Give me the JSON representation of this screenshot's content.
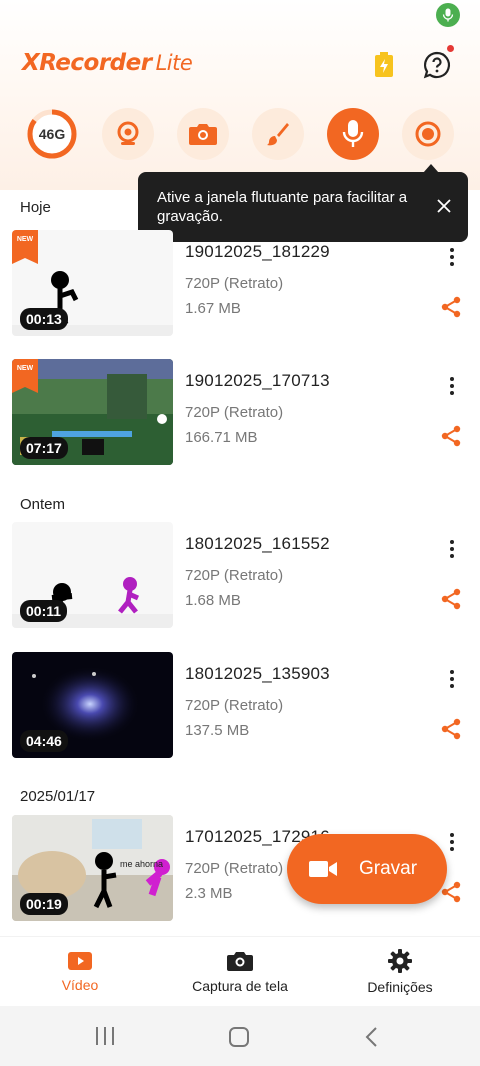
{
  "app": {
    "title": "XRecorder",
    "title_suffix": "Lite",
    "accent": "#f26722"
  },
  "quick_actions": {
    "storage_label": "46G",
    "items": [
      "storage",
      "facecam-icon",
      "screenshot-icon",
      "brush-icon",
      "microphone-icon",
      "record-icon"
    ]
  },
  "tooltip": {
    "text": "Ative a janela flutuante para facilitar a gravação."
  },
  "sections": [
    {
      "label": "Hoje",
      "videos": [
        {
          "name": "19012025_181229",
          "resolution": "720P (Retrato)",
          "size": "1.67 MB",
          "duration": "00:13",
          "badge": "NEW"
        },
        {
          "name": "19012025_170713",
          "resolution": "720P (Retrato)",
          "size": "166.71 MB",
          "duration": "07:17",
          "badge": "NEW"
        }
      ]
    },
    {
      "label": "Ontem",
      "videos": [
        {
          "name": "18012025_161552",
          "resolution": "720P (Retrato)",
          "size": "1.68 MB",
          "duration": "00:11"
        },
        {
          "name": "18012025_135903",
          "resolution": "720P (Retrato)",
          "size": "137.5 MB",
          "duration": "04:46"
        }
      ]
    },
    {
      "label": "2025/01/17",
      "videos": [
        {
          "name": "17012025_172916",
          "resolution": "720P (Retrato)",
          "size": "2.3 MB",
          "duration": "00:19",
          "thumb_caption": "me ahorna"
        }
      ]
    }
  ],
  "fab": {
    "label": "Gravar"
  },
  "bottom_nav": [
    {
      "label": "Vídeo",
      "icon": "video-icon",
      "active": true
    },
    {
      "label": "Captura de tela",
      "icon": "camera-icon",
      "active": false
    },
    {
      "label": "Definições",
      "icon": "gear-icon",
      "active": false
    }
  ]
}
